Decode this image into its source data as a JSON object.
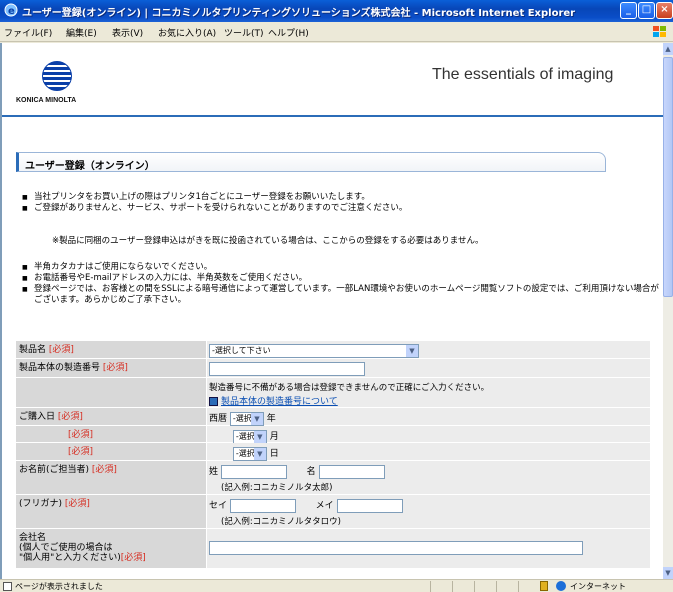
{
  "window": {
    "title": "ユーザー登録(オンライン) | コニカミノルタプリンティングソリューションズ株式会社 - Microsoft Internet Explorer"
  },
  "menubar": {
    "items": [
      "ファイル(F)",
      "編集(E)",
      "表示(V)",
      "お気に入り(A)",
      "ツール(T)",
      "ヘルプ(H)"
    ]
  },
  "header": {
    "logo_text": "KONICA MINOLTA",
    "tagline": "The essentials of imaging"
  },
  "section": {
    "title": "ユーザー登録（オンライン）"
  },
  "intro": {
    "bullets1": [
      "当社プリンタをお買い上げの際はプリンタ1台ごとにユーザー登録をお願いいたします。",
      "ご登録がありませんと、サービス、サポートを受けられないことがありますのでご注意ください。"
    ],
    "note": "※製品に同梱のユーザー登録申込はがきを既に投函されている場合は、ここからの登録をする必要はありません。",
    "bullets2": [
      "半角カタカナはご使用にならないでください。",
      "お電話番号やE-mailアドレスの入力には、半角英数をご使用ください。",
      "登録ページでは、お客様との間をSSLによる暗号通信によって運営しています。一部LAN環境やお使いのホームページ閲覧ソフトの設定では、ご利用頂けない場合がございます。あらかじめご了承下さい。"
    ]
  },
  "form": {
    "required": "[必須]",
    "product": {
      "label": "製品名",
      "select_value": "-選択して下さい"
    },
    "serial": {
      "label": "製品本体の製造番号",
      "help": "製造番号に不備がある場合は登録できませんので正確にご入力ください。",
      "link": "製品本体の製造番号について"
    },
    "purchase": {
      "label": "ご購入日",
      "era": "西暦",
      "select_placeholder": "-選択",
      "year_unit": "年",
      "month_unit": "月",
      "day_unit": "日"
    },
    "name": {
      "label": "お名前(ご担当者)",
      "sei": "姓",
      "mei": "名",
      "example": "(記入例:コニカミノルタ太郎)"
    },
    "kana": {
      "label": "(フリガナ)",
      "sei": "セイ",
      "mei": "メイ",
      "example": "(記入例:コニカミノルタタロウ)"
    },
    "company": {
      "label_line1": "会社名",
      "label_line2": "(個人でご使用の場合は",
      "label_line3": "\"個人用\"と入力ください)"
    }
  },
  "statusbar": {
    "status": "ページが表示されました",
    "zone": "インターネット"
  }
}
